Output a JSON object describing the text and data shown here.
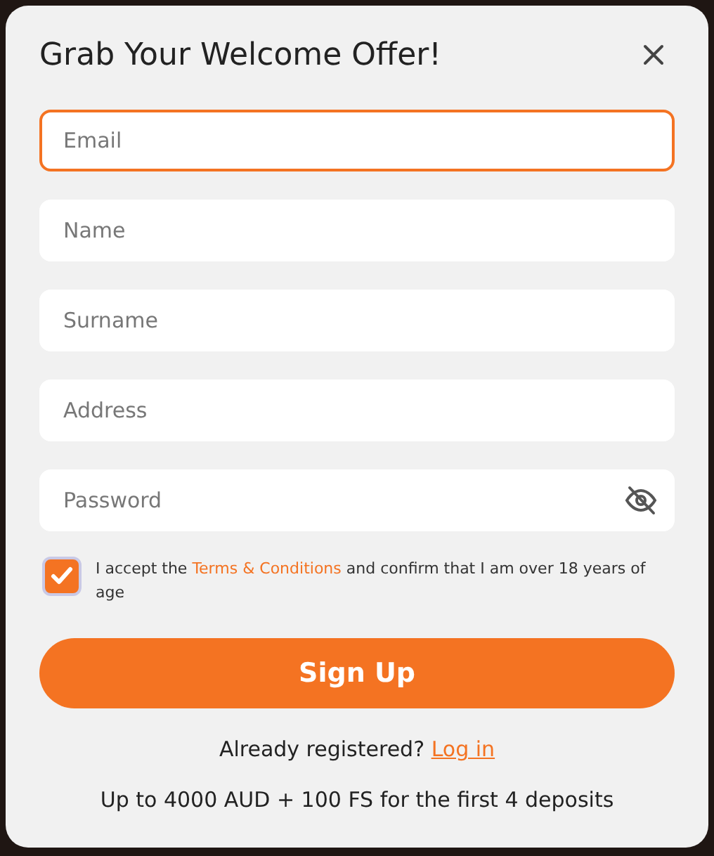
{
  "dialog": {
    "title": "Grab Your Welcome Offer!"
  },
  "fields": [
    {
      "placeholder": "Email",
      "kind": "text",
      "focused": true
    },
    {
      "placeholder": "Name",
      "kind": "text",
      "focused": false
    },
    {
      "placeholder": "Surname",
      "kind": "text",
      "focused": false
    },
    {
      "placeholder": "Address",
      "kind": "text",
      "focused": false
    },
    {
      "placeholder": "Password",
      "kind": "password",
      "focused": false
    }
  ],
  "consent": {
    "checked": true,
    "text_before": "I accept the ",
    "link": "Terms & Conditions",
    "text_after": " and confirm that I am over 18 years of age"
  },
  "submit_button": "Sign Up",
  "login": {
    "prompt": "Already registered? ",
    "link": "Log in"
  },
  "offer": "Up to 4000 AUD + 100 FS for the first 4 deposits"
}
